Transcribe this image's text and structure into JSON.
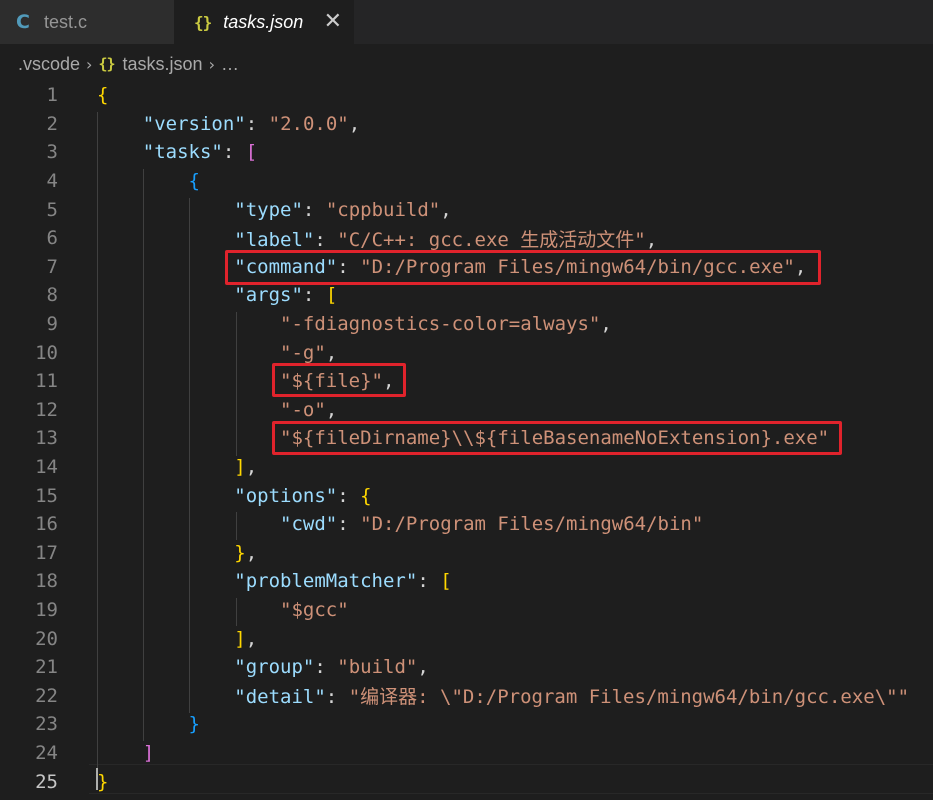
{
  "tabs": [
    {
      "icon": "C",
      "label": "test.c",
      "active": false
    },
    {
      "icon": "{}",
      "label": "tasks.json",
      "active": true,
      "close": "✕"
    }
  ],
  "breadcrumb": {
    "folder": ".vscode",
    "icon": "{}",
    "file": "tasks.json",
    "ellipsis": "…"
  },
  "editor": {
    "current_line": 25,
    "lines": [
      {
        "n": "1",
        "code": "{"
      },
      {
        "n": "2",
        "code": "    \"version\": \"2.0.0\","
      },
      {
        "n": "3",
        "code": "    \"tasks\": ["
      },
      {
        "n": "4",
        "code": "        {"
      },
      {
        "n": "5",
        "code": "            \"type\": \"cppbuild\","
      },
      {
        "n": "6",
        "code": "            \"label\": \"C/C++: gcc.exe 生成活动文件\","
      },
      {
        "n": "7",
        "code": "            \"command\": \"D:/Program Files/mingw64/bin/gcc.exe\","
      },
      {
        "n": "8",
        "code": "            \"args\": ["
      },
      {
        "n": "9",
        "code": "                \"-fdiagnostics-color=always\","
      },
      {
        "n": "10",
        "code": "                \"-g\","
      },
      {
        "n": "11",
        "code": "                \"${file}\","
      },
      {
        "n": "12",
        "code": "                \"-o\","
      },
      {
        "n": "13",
        "code": "                \"${fileDirname}\\\\${fileBasenameNoExtension}.exe\""
      },
      {
        "n": "14",
        "code": "            ],"
      },
      {
        "n": "15",
        "code": "            \"options\": {"
      },
      {
        "n": "16",
        "code": "                \"cwd\": \"D:/Program Files/mingw64/bin\""
      },
      {
        "n": "17",
        "code": "            },"
      },
      {
        "n": "18",
        "code": "            \"problemMatcher\": ["
      },
      {
        "n": "19",
        "code": "                \"$gcc\""
      },
      {
        "n": "20",
        "code": "            ],"
      },
      {
        "n": "21",
        "code": "            \"group\": \"build\","
      },
      {
        "n": "22",
        "code": "            \"detail\": \"编译器: \\\"D:/Program Files/mingw64/bin/gcc.exe\\\"\""
      },
      {
        "n": "23",
        "code": "        }"
      },
      {
        "n": "24",
        "code": "    ]"
      },
      {
        "n": "25",
        "code": "}"
      }
    ]
  },
  "colors": {
    "key": "#9cdcfe",
    "string": "#ce9178",
    "bracket_level1": "#ffd700",
    "bracket_level2": "#da70d6",
    "bracket_level3": "#179fff",
    "highlight_box": "#e0232c"
  }
}
